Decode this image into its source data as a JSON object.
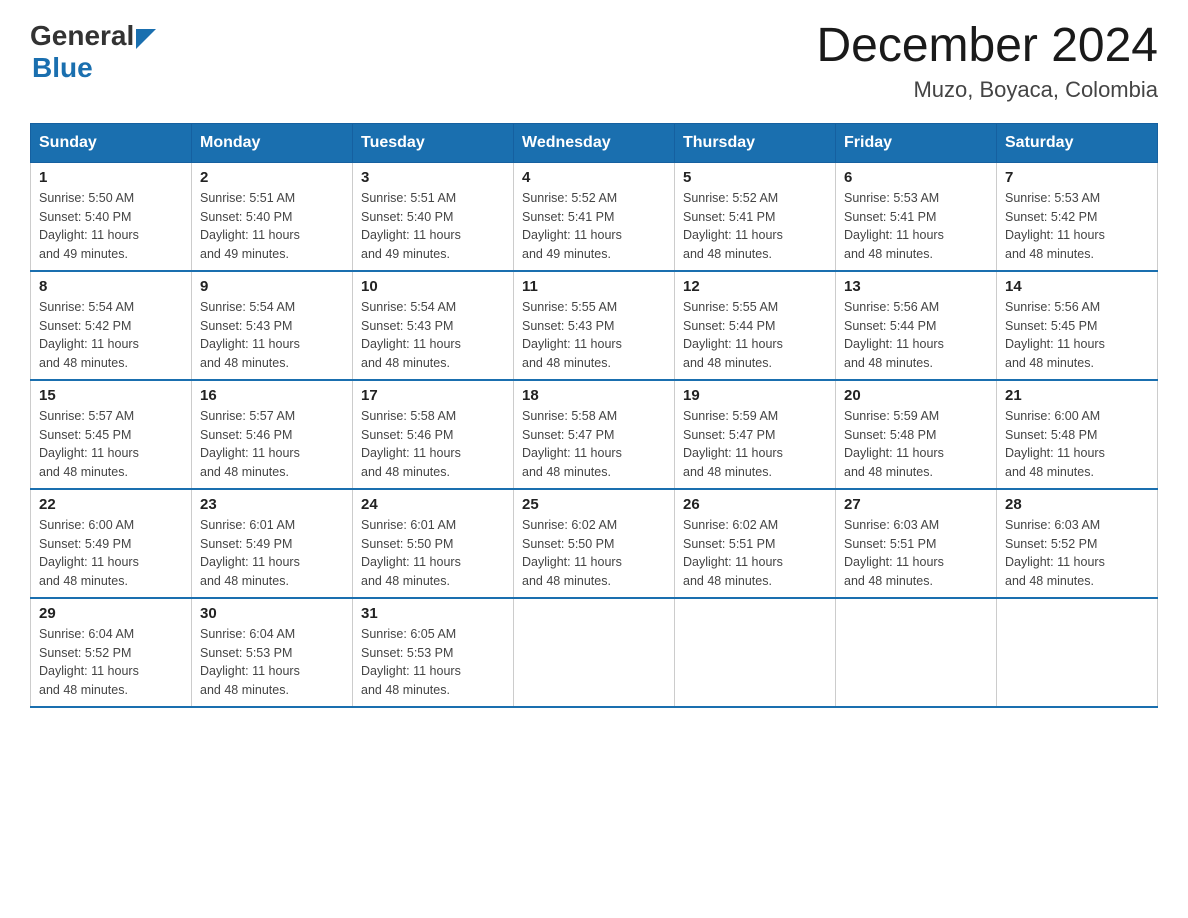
{
  "header": {
    "logo_general": "General",
    "logo_blue": "Blue",
    "month_year": "December 2024",
    "location": "Muzo, Boyaca, Colombia"
  },
  "calendar": {
    "days_of_week": [
      "Sunday",
      "Monday",
      "Tuesday",
      "Wednesday",
      "Thursday",
      "Friday",
      "Saturday"
    ],
    "weeks": [
      [
        {
          "day": "1",
          "sunrise": "5:50 AM",
          "sunset": "5:40 PM",
          "daylight": "11 hours and 49 minutes."
        },
        {
          "day": "2",
          "sunrise": "5:51 AM",
          "sunset": "5:40 PM",
          "daylight": "11 hours and 49 minutes."
        },
        {
          "day": "3",
          "sunrise": "5:51 AM",
          "sunset": "5:40 PM",
          "daylight": "11 hours and 49 minutes."
        },
        {
          "day": "4",
          "sunrise": "5:52 AM",
          "sunset": "5:41 PM",
          "daylight": "11 hours and 49 minutes."
        },
        {
          "day": "5",
          "sunrise": "5:52 AM",
          "sunset": "5:41 PM",
          "daylight": "11 hours and 48 minutes."
        },
        {
          "day": "6",
          "sunrise": "5:53 AM",
          "sunset": "5:41 PM",
          "daylight": "11 hours and 48 minutes."
        },
        {
          "day": "7",
          "sunrise": "5:53 AM",
          "sunset": "5:42 PM",
          "daylight": "11 hours and 48 minutes."
        }
      ],
      [
        {
          "day": "8",
          "sunrise": "5:54 AM",
          "sunset": "5:42 PM",
          "daylight": "11 hours and 48 minutes."
        },
        {
          "day": "9",
          "sunrise": "5:54 AM",
          "sunset": "5:43 PM",
          "daylight": "11 hours and 48 minutes."
        },
        {
          "day": "10",
          "sunrise": "5:54 AM",
          "sunset": "5:43 PM",
          "daylight": "11 hours and 48 minutes."
        },
        {
          "day": "11",
          "sunrise": "5:55 AM",
          "sunset": "5:43 PM",
          "daylight": "11 hours and 48 minutes."
        },
        {
          "day": "12",
          "sunrise": "5:55 AM",
          "sunset": "5:44 PM",
          "daylight": "11 hours and 48 minutes."
        },
        {
          "day": "13",
          "sunrise": "5:56 AM",
          "sunset": "5:44 PM",
          "daylight": "11 hours and 48 minutes."
        },
        {
          "day": "14",
          "sunrise": "5:56 AM",
          "sunset": "5:45 PM",
          "daylight": "11 hours and 48 minutes."
        }
      ],
      [
        {
          "day": "15",
          "sunrise": "5:57 AM",
          "sunset": "5:45 PM",
          "daylight": "11 hours and 48 minutes."
        },
        {
          "day": "16",
          "sunrise": "5:57 AM",
          "sunset": "5:46 PM",
          "daylight": "11 hours and 48 minutes."
        },
        {
          "day": "17",
          "sunrise": "5:58 AM",
          "sunset": "5:46 PM",
          "daylight": "11 hours and 48 minutes."
        },
        {
          "day": "18",
          "sunrise": "5:58 AM",
          "sunset": "5:47 PM",
          "daylight": "11 hours and 48 minutes."
        },
        {
          "day": "19",
          "sunrise": "5:59 AM",
          "sunset": "5:47 PM",
          "daylight": "11 hours and 48 minutes."
        },
        {
          "day": "20",
          "sunrise": "5:59 AM",
          "sunset": "5:48 PM",
          "daylight": "11 hours and 48 minutes."
        },
        {
          "day": "21",
          "sunrise": "6:00 AM",
          "sunset": "5:48 PM",
          "daylight": "11 hours and 48 minutes."
        }
      ],
      [
        {
          "day": "22",
          "sunrise": "6:00 AM",
          "sunset": "5:49 PM",
          "daylight": "11 hours and 48 minutes."
        },
        {
          "day": "23",
          "sunrise": "6:01 AM",
          "sunset": "5:49 PM",
          "daylight": "11 hours and 48 minutes."
        },
        {
          "day": "24",
          "sunrise": "6:01 AM",
          "sunset": "5:50 PM",
          "daylight": "11 hours and 48 minutes."
        },
        {
          "day": "25",
          "sunrise": "6:02 AM",
          "sunset": "5:50 PM",
          "daylight": "11 hours and 48 minutes."
        },
        {
          "day": "26",
          "sunrise": "6:02 AM",
          "sunset": "5:51 PM",
          "daylight": "11 hours and 48 minutes."
        },
        {
          "day": "27",
          "sunrise": "6:03 AM",
          "sunset": "5:51 PM",
          "daylight": "11 hours and 48 minutes."
        },
        {
          "day": "28",
          "sunrise": "6:03 AM",
          "sunset": "5:52 PM",
          "daylight": "11 hours and 48 minutes."
        }
      ],
      [
        {
          "day": "29",
          "sunrise": "6:04 AM",
          "sunset": "5:52 PM",
          "daylight": "11 hours and 48 minutes."
        },
        {
          "day": "30",
          "sunrise": "6:04 AM",
          "sunset": "5:53 PM",
          "daylight": "11 hours and 48 minutes."
        },
        {
          "day": "31",
          "sunrise": "6:05 AM",
          "sunset": "5:53 PM",
          "daylight": "11 hours and 48 minutes."
        },
        null,
        null,
        null,
        null
      ]
    ]
  },
  "labels": {
    "sunrise_prefix": "Sunrise: ",
    "sunset_prefix": "Sunset: ",
    "daylight_prefix": "Daylight: "
  }
}
